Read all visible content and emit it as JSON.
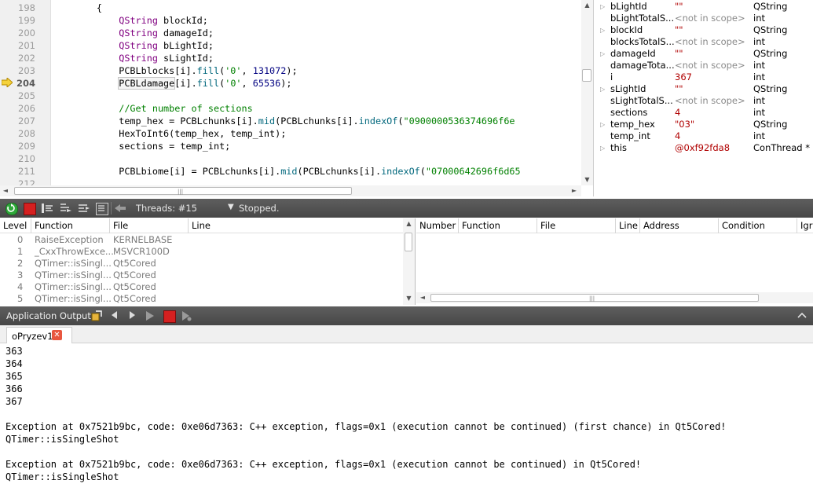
{
  "editor": {
    "lines": [
      {
        "n": "198",
        "code": "        {"
      },
      {
        "n": "199",
        "code": "            QString blockId;"
      },
      {
        "n": "200",
        "code": "            QString damageId;"
      },
      {
        "n": "201",
        "code": "            QString bLightId;"
      },
      {
        "n": "202",
        "code": "            QString sLightId;"
      },
      {
        "n": "203",
        "code": "            PCBLblocks[i].fill('0', 131072);"
      },
      {
        "n": "204",
        "code": "            PCBLdamage[i].fill('0', 65536);"
      },
      {
        "n": "205",
        "code": ""
      },
      {
        "n": "206",
        "code": "            //Get number of sections"
      },
      {
        "n": "207",
        "code": "            temp_hex = PCBLchunks[i].mid(PCBLchunks[i].indexOf(\"0900000536374696f6e"
      },
      {
        "n": "208",
        "code": "            HexToInt6(temp_hex, temp_int);"
      },
      {
        "n": "209",
        "code": "            sections = temp_int;"
      },
      {
        "n": "210",
        "code": ""
      },
      {
        "n": "211",
        "code": "            PCBLbiome[i] = PCBLchunks[i].mid(PCBLchunks[i].indexOf(\"07000642696f6d65"
      },
      {
        "n": "212",
        "code": ""
      }
    ],
    "current_line": "204"
  },
  "locals": [
    {
      "expand": true,
      "name": "bLightId",
      "value": "\"\"",
      "type": "QString",
      "nis": false
    },
    {
      "expand": false,
      "name": "bLightTotalS...",
      "value": "<not in scope>",
      "type": "int",
      "nis": true
    },
    {
      "expand": true,
      "name": "blockId",
      "value": "\"\"",
      "type": "QString",
      "nis": false
    },
    {
      "expand": false,
      "name": "blocksTotalS...",
      "value": "<not in scope>",
      "type": "int",
      "nis": true
    },
    {
      "expand": true,
      "name": "damageId",
      "value": "\"\"",
      "type": "QString",
      "nis": false
    },
    {
      "expand": false,
      "name": "damageTota...",
      "value": "<not in scope>",
      "type": "int",
      "nis": true
    },
    {
      "expand": false,
      "name": "i",
      "value": "367",
      "type": "int",
      "nis": false
    },
    {
      "expand": true,
      "name": "sLightId",
      "value": "\"\"",
      "type": "QString",
      "nis": false
    },
    {
      "expand": false,
      "name": "sLightTotalS...",
      "value": "<not in scope>",
      "type": "int",
      "nis": true
    },
    {
      "expand": false,
      "name": "sections",
      "value": "4",
      "type": "int",
      "nis": false
    },
    {
      "expand": true,
      "name": "temp_hex",
      "value": "\"03\"",
      "type": "QString",
      "nis": false
    },
    {
      "expand": false,
      "name": "temp_int",
      "value": "4",
      "type": "int",
      "nis": false
    },
    {
      "expand": true,
      "name": "this",
      "value": "@0xf92fda8",
      "type": "ConThread *",
      "nis": false
    }
  ],
  "debug_toolbar": {
    "threads_label": "Threads:",
    "threads_value": "#15",
    "status": "Stopped."
  },
  "stack": {
    "columns": [
      "Level",
      "Function",
      "File",
      "Line"
    ],
    "rows": [
      {
        "level": "0",
        "function": "RaiseException",
        "file": "KERNELBASE"
      },
      {
        "level": "1",
        "function": "_CxxThrowExce...",
        "file": "MSVCR100D"
      },
      {
        "level": "2",
        "function": "QTimer::isSingl...",
        "file": "Qt5Cored"
      },
      {
        "level": "3",
        "function": "QTimer::isSingl...",
        "file": "Qt5Cored"
      },
      {
        "level": "4",
        "function": "QTimer::isSingl...",
        "file": "Qt5Cored"
      },
      {
        "level": "5",
        "function": "QTimer::isSingl...",
        "file": "Qt5Cored"
      }
    ]
  },
  "breakpoints": {
    "columns": [
      "Number",
      "Function",
      "File",
      "Line",
      "Address",
      "Condition",
      "Igr"
    ]
  },
  "output": {
    "title": "Application Output",
    "tab_label": "oPryzev1",
    "lines": [
      "363",
      "364",
      "365",
      "366",
      "367",
      "",
      "Exception at 0x7521b9bc, code: 0xe06d7363: C++ exception, flags=0x1 (execution cannot be continued) (first chance) in Qt5Cored!",
      "QTimer::isSingleShot",
      "",
      "Exception at 0x7521b9bc, code: 0xe06d7363: C++ exception, flags=0x1 (execution cannot be continued) in Qt5Cored!",
      "QTimer::isSingleShot"
    ]
  },
  "colors": {
    "keyword": "#800080",
    "string": "#008000",
    "number": "#000080",
    "value_red": "#b00000",
    "toolbar_bg": "#4f4f4f"
  }
}
